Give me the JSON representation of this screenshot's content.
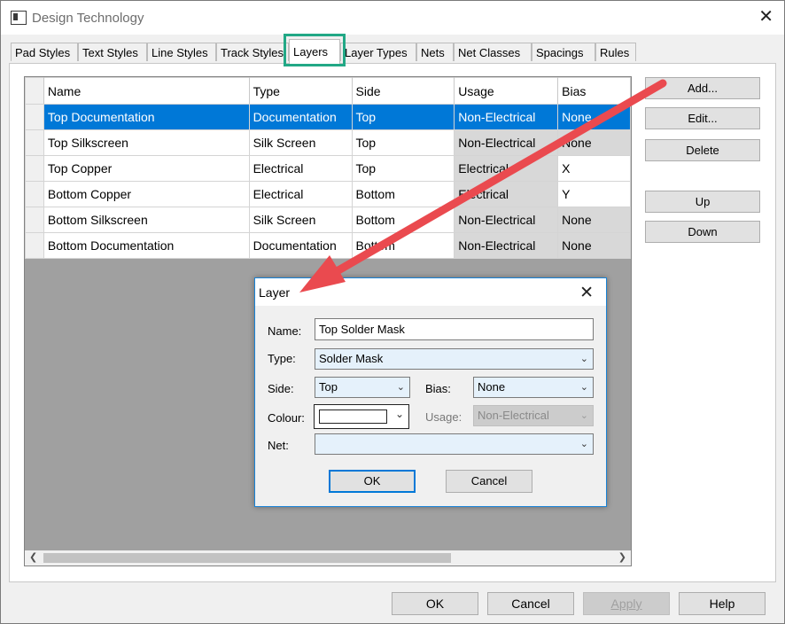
{
  "window": {
    "title": "Design Technology"
  },
  "tabs": [
    "Pad Styles",
    "Text Styles",
    "Line Styles",
    "Track Styles",
    "Layers",
    "Layer Types",
    "Nets",
    "Net Classes",
    "Spacings",
    "Rules"
  ],
  "table": {
    "columns": [
      "Name",
      "Type",
      "Side",
      "Usage",
      "Bias"
    ],
    "rows": [
      [
        "Top Documentation",
        "Documentation",
        "Top",
        "Non-Electrical",
        "None"
      ],
      [
        "Top Silkscreen",
        "Silk Screen",
        "Top",
        "Non-Electrical",
        "None"
      ],
      [
        "Top Copper",
        "Electrical",
        "Top",
        "Electrical",
        "X"
      ],
      [
        "Bottom Copper",
        "Electrical",
        "Bottom",
        "Electrical",
        "Y"
      ],
      [
        "Bottom Silkscreen",
        "Silk Screen",
        "Bottom",
        "Non-Electrical",
        "None"
      ],
      [
        "Bottom Documentation",
        "Documentation",
        "Bottom",
        "Non-Electrical",
        "None"
      ]
    ],
    "selected_row": 0
  },
  "side_buttons": {
    "add": "Add...",
    "edit": "Edit...",
    "delete": "Delete",
    "up": "Up",
    "down": "Down"
  },
  "footer": {
    "ok": "OK",
    "cancel": "Cancel",
    "apply": "Apply",
    "help": "Help"
  },
  "dialog": {
    "title": "Layer",
    "name_label": "Name:",
    "name_value": "Top Solder Mask",
    "type_label": "Type:",
    "type_value": "Solder Mask",
    "side_label": "Side:",
    "side_value": "Top",
    "bias_label": "Bias:",
    "bias_value": "None",
    "colour_label": "Colour:",
    "usage_label": "Usage:",
    "usage_value": "Non-Electrical",
    "net_label": "Net:",
    "net_value": "",
    "ok": "OK",
    "cancel": "Cancel"
  },
  "colors": {
    "selection": "#0078d7",
    "tab_highlight": "#22a886",
    "annotation_arrow": "#ea4a4f",
    "dialog_border": "#1883d7"
  }
}
